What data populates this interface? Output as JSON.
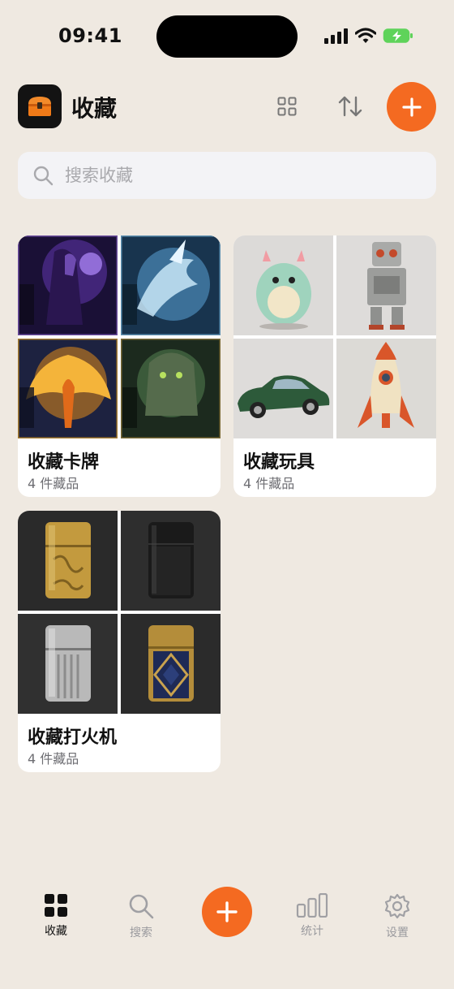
{
  "status_bar": {
    "time": "09:41"
  },
  "header": {
    "title": "收藏"
  },
  "search": {
    "placeholder": "搜索收藏"
  },
  "collections": [
    {
      "title": "收藏卡牌",
      "count": "4 件藏品"
    },
    {
      "title": "收藏玩具",
      "count": "4 件藏品"
    },
    {
      "title": "收藏打火机",
      "count": "4 件藏品"
    }
  ],
  "tabbar": {
    "items": [
      {
        "label": "收藏",
        "icon": "grid-icon",
        "active": true
      },
      {
        "label": "搜索",
        "icon": "search-icon",
        "active": false
      },
      {
        "label": "统计",
        "icon": "bar-chart-icon",
        "active": false
      },
      {
        "label": "设置",
        "icon": "gear-icon",
        "active": false
      }
    ]
  },
  "colors": {
    "accent": "#f46a21",
    "background": "#efe9e1",
    "active_tab": "#111111",
    "inactive_tab": "#9a9a9e"
  }
}
